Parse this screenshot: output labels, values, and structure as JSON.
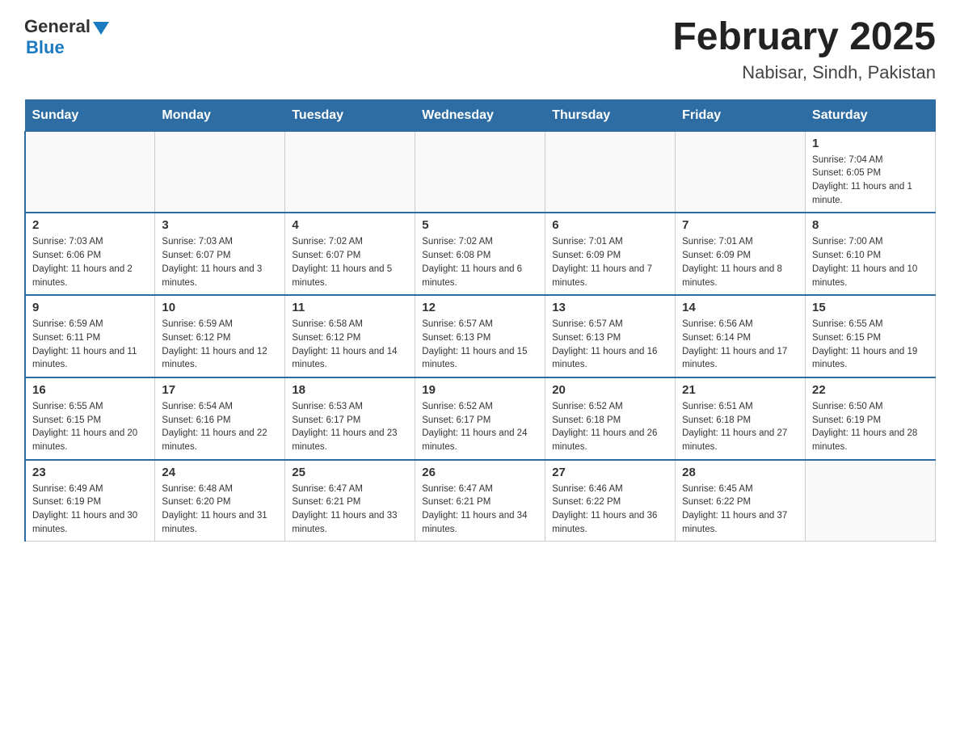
{
  "header": {
    "logo_general": "General",
    "logo_blue": "Blue",
    "month_year": "February 2025",
    "location": "Nabisar, Sindh, Pakistan"
  },
  "weekdays": [
    "Sunday",
    "Monday",
    "Tuesday",
    "Wednesday",
    "Thursday",
    "Friday",
    "Saturday"
  ],
  "weeks": [
    [
      {
        "day": "",
        "sunrise": "",
        "sunset": "",
        "daylight": ""
      },
      {
        "day": "",
        "sunrise": "",
        "sunset": "",
        "daylight": ""
      },
      {
        "day": "",
        "sunrise": "",
        "sunset": "",
        "daylight": ""
      },
      {
        "day": "",
        "sunrise": "",
        "sunset": "",
        "daylight": ""
      },
      {
        "day": "",
        "sunrise": "",
        "sunset": "",
        "daylight": ""
      },
      {
        "day": "",
        "sunrise": "",
        "sunset": "",
        "daylight": ""
      },
      {
        "day": "1",
        "sunrise": "Sunrise: 7:04 AM",
        "sunset": "Sunset: 6:05 PM",
        "daylight": "Daylight: 11 hours and 1 minute."
      }
    ],
    [
      {
        "day": "2",
        "sunrise": "Sunrise: 7:03 AM",
        "sunset": "Sunset: 6:06 PM",
        "daylight": "Daylight: 11 hours and 2 minutes."
      },
      {
        "day": "3",
        "sunrise": "Sunrise: 7:03 AM",
        "sunset": "Sunset: 6:07 PM",
        "daylight": "Daylight: 11 hours and 3 minutes."
      },
      {
        "day": "4",
        "sunrise": "Sunrise: 7:02 AM",
        "sunset": "Sunset: 6:07 PM",
        "daylight": "Daylight: 11 hours and 5 minutes."
      },
      {
        "day": "5",
        "sunrise": "Sunrise: 7:02 AM",
        "sunset": "Sunset: 6:08 PM",
        "daylight": "Daylight: 11 hours and 6 minutes."
      },
      {
        "day": "6",
        "sunrise": "Sunrise: 7:01 AM",
        "sunset": "Sunset: 6:09 PM",
        "daylight": "Daylight: 11 hours and 7 minutes."
      },
      {
        "day": "7",
        "sunrise": "Sunrise: 7:01 AM",
        "sunset": "Sunset: 6:09 PM",
        "daylight": "Daylight: 11 hours and 8 minutes."
      },
      {
        "day": "8",
        "sunrise": "Sunrise: 7:00 AM",
        "sunset": "Sunset: 6:10 PM",
        "daylight": "Daylight: 11 hours and 10 minutes."
      }
    ],
    [
      {
        "day": "9",
        "sunrise": "Sunrise: 6:59 AM",
        "sunset": "Sunset: 6:11 PM",
        "daylight": "Daylight: 11 hours and 11 minutes."
      },
      {
        "day": "10",
        "sunrise": "Sunrise: 6:59 AM",
        "sunset": "Sunset: 6:12 PM",
        "daylight": "Daylight: 11 hours and 12 minutes."
      },
      {
        "day": "11",
        "sunrise": "Sunrise: 6:58 AM",
        "sunset": "Sunset: 6:12 PM",
        "daylight": "Daylight: 11 hours and 14 minutes."
      },
      {
        "day": "12",
        "sunrise": "Sunrise: 6:57 AM",
        "sunset": "Sunset: 6:13 PM",
        "daylight": "Daylight: 11 hours and 15 minutes."
      },
      {
        "day": "13",
        "sunrise": "Sunrise: 6:57 AM",
        "sunset": "Sunset: 6:13 PM",
        "daylight": "Daylight: 11 hours and 16 minutes."
      },
      {
        "day": "14",
        "sunrise": "Sunrise: 6:56 AM",
        "sunset": "Sunset: 6:14 PM",
        "daylight": "Daylight: 11 hours and 17 minutes."
      },
      {
        "day": "15",
        "sunrise": "Sunrise: 6:55 AM",
        "sunset": "Sunset: 6:15 PM",
        "daylight": "Daylight: 11 hours and 19 minutes."
      }
    ],
    [
      {
        "day": "16",
        "sunrise": "Sunrise: 6:55 AM",
        "sunset": "Sunset: 6:15 PM",
        "daylight": "Daylight: 11 hours and 20 minutes."
      },
      {
        "day": "17",
        "sunrise": "Sunrise: 6:54 AM",
        "sunset": "Sunset: 6:16 PM",
        "daylight": "Daylight: 11 hours and 22 minutes."
      },
      {
        "day": "18",
        "sunrise": "Sunrise: 6:53 AM",
        "sunset": "Sunset: 6:17 PM",
        "daylight": "Daylight: 11 hours and 23 minutes."
      },
      {
        "day": "19",
        "sunrise": "Sunrise: 6:52 AM",
        "sunset": "Sunset: 6:17 PM",
        "daylight": "Daylight: 11 hours and 24 minutes."
      },
      {
        "day": "20",
        "sunrise": "Sunrise: 6:52 AM",
        "sunset": "Sunset: 6:18 PM",
        "daylight": "Daylight: 11 hours and 26 minutes."
      },
      {
        "day": "21",
        "sunrise": "Sunrise: 6:51 AM",
        "sunset": "Sunset: 6:18 PM",
        "daylight": "Daylight: 11 hours and 27 minutes."
      },
      {
        "day": "22",
        "sunrise": "Sunrise: 6:50 AM",
        "sunset": "Sunset: 6:19 PM",
        "daylight": "Daylight: 11 hours and 28 minutes."
      }
    ],
    [
      {
        "day": "23",
        "sunrise": "Sunrise: 6:49 AM",
        "sunset": "Sunset: 6:19 PM",
        "daylight": "Daylight: 11 hours and 30 minutes."
      },
      {
        "day": "24",
        "sunrise": "Sunrise: 6:48 AM",
        "sunset": "Sunset: 6:20 PM",
        "daylight": "Daylight: 11 hours and 31 minutes."
      },
      {
        "day": "25",
        "sunrise": "Sunrise: 6:47 AM",
        "sunset": "Sunset: 6:21 PM",
        "daylight": "Daylight: 11 hours and 33 minutes."
      },
      {
        "day": "26",
        "sunrise": "Sunrise: 6:47 AM",
        "sunset": "Sunset: 6:21 PM",
        "daylight": "Daylight: 11 hours and 34 minutes."
      },
      {
        "day": "27",
        "sunrise": "Sunrise: 6:46 AM",
        "sunset": "Sunset: 6:22 PM",
        "daylight": "Daylight: 11 hours and 36 minutes."
      },
      {
        "day": "28",
        "sunrise": "Sunrise: 6:45 AM",
        "sunset": "Sunset: 6:22 PM",
        "daylight": "Daylight: 11 hours and 37 minutes."
      },
      {
        "day": "",
        "sunrise": "",
        "sunset": "",
        "daylight": ""
      }
    ]
  ]
}
